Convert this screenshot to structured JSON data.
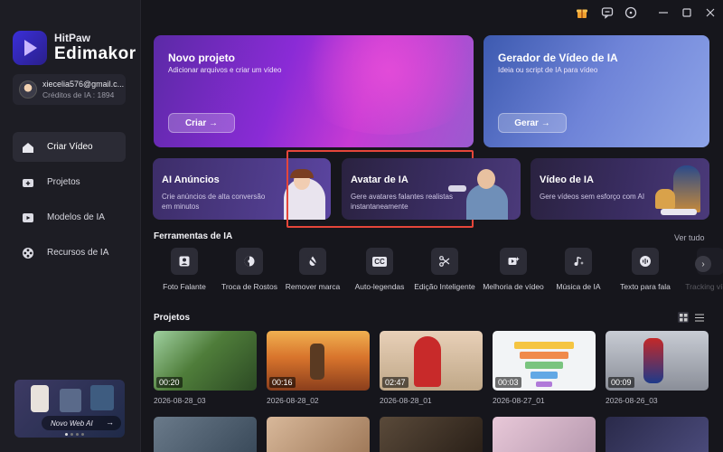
{
  "app": {
    "brand_small": "HitPaw",
    "brand_big": "Edimakor"
  },
  "account": {
    "email": "xiecelia576@gmail.c...",
    "credits": "Créditos de IA : 1894"
  },
  "nav": [
    {
      "label": "Criar Vídeo",
      "icon": "home-icon",
      "active": true
    },
    {
      "label": "Projetos",
      "icon": "folder-plus-icon",
      "active": false
    },
    {
      "label": "Modelos de IA",
      "icon": "template-icon",
      "active": false
    },
    {
      "label": "Recursos de IA",
      "icon": "film-reel-icon",
      "active": false
    }
  ],
  "promo": {
    "label": "Novo Web AI"
  },
  "hero": {
    "novo": {
      "title": "Novo projeto",
      "subtitle": "Adicionar arquivos e criar um vídeo",
      "button": "Criar →"
    },
    "gerador": {
      "title": "Gerador de Vídeo de IA",
      "subtitle": "Ideia ou script de IA para vídeo",
      "button": "Gerar →"
    }
  },
  "features": [
    {
      "title": "AI Anúncios",
      "subtitle": "Crie anúncios de alta conversão em minutos"
    },
    {
      "title": "Avatar de IA",
      "subtitle": "Gere avatares falantes realistas instantaneamente"
    },
    {
      "title": "Vídeo de IA",
      "subtitle": "Gere vídeos sem esforço com AI"
    }
  ],
  "tools_section": {
    "title": "Ferramentas de IA",
    "see_all": "Ver tudo",
    "items": [
      {
        "label": "Foto Falante",
        "icon": "talking-photo-icon"
      },
      {
        "label": "Troca de Rostos",
        "icon": "face-swap-icon"
      },
      {
        "label": "Remover marca",
        "icon": "remove-watermark-icon"
      },
      {
        "label": "Auto-legendas",
        "icon": "cc-icon",
        "glyph": "CC"
      },
      {
        "label": "Edição Inteligente",
        "icon": "smart-edit-icon"
      },
      {
        "label": "Melhoria de vídeo",
        "icon": "video-enhance-icon"
      },
      {
        "label": "Música de IA",
        "icon": "music-icon"
      },
      {
        "label": "Texto para fala",
        "icon": "tts-icon"
      },
      {
        "label": "Tracking vídeo",
        "icon": "tracking-icon"
      }
    ]
  },
  "projects_section": {
    "title": "Projetos",
    "items": [
      {
        "duration": "00:20",
        "date": "2026-08-28_03",
        "theme": "#3f6b3a"
      },
      {
        "duration": "00:16",
        "date": "2026-08-28_02",
        "theme": "#c2682a"
      },
      {
        "duration": "02:47",
        "date": "2026-08-28_01",
        "theme": "#b8322c"
      },
      {
        "duration": "00:03",
        "date": "2026-08-27_01",
        "theme": "#e9eef2"
      },
      {
        "duration": "00:09",
        "date": "2026-08-26_03",
        "theme": "#8a8c94"
      }
    ]
  },
  "colors": {
    "accent_highlight": "#e5463a",
    "background": "#16161c",
    "sidebar": "#1d1d24"
  }
}
